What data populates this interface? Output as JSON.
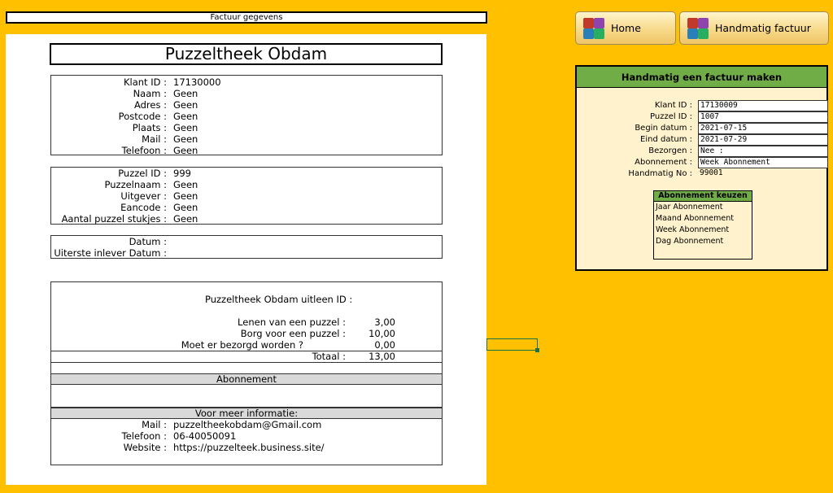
{
  "sheet": {
    "title_bar": "Factuur gegevens",
    "shop_name": "Puzzeltheek Obdam"
  },
  "customer": {
    "rows": [
      {
        "label": "Klant ID :",
        "value": "17130000"
      },
      {
        "label": "Naam :",
        "value": "Geen"
      },
      {
        "label": "Adres :",
        "value": "Geen"
      },
      {
        "label": "Postcode :",
        "value": "Geen"
      },
      {
        "label": "Plaats :",
        "value": "Geen"
      },
      {
        "label": "Mail :",
        "value": "Geen"
      },
      {
        "label": "Telefoon :",
        "value": "Geen"
      }
    ]
  },
  "puzzle": {
    "rows": [
      {
        "label": "Puzzel ID :",
        "value": "999"
      },
      {
        "label": "Puzzelnaam :",
        "value": "Geen"
      },
      {
        "label": "Uitgever :",
        "value": "Geen"
      },
      {
        "label": "Eancode :",
        "value": "Geen"
      },
      {
        "label": "Aantal puzzel stukjes :",
        "value": "Geen"
      }
    ]
  },
  "dates": {
    "rows": [
      {
        "label": "Datum :",
        "value": ""
      },
      {
        "label": "Uiterste inlever Datum :",
        "value": ""
      }
    ]
  },
  "costs": {
    "loan_id_label": "Puzzeltheek Obdam uitleen ID :",
    "lines": [
      {
        "label": "Lenen van een puzzel :",
        "amount": "3,00"
      },
      {
        "label": "Borg voor een puzzel :",
        "amount": "10,00"
      },
      {
        "label": "Moet er bezorgd worden ?",
        "amount": "0,00"
      }
    ],
    "total_label": "Totaal :",
    "total_amount": "13,00",
    "subscription_header": "Abonnement",
    "info_header": "Voor meer informatie:",
    "info_rows": [
      {
        "label": "Mail :",
        "value": "puzzeltheekobdam@Gmail.com"
      },
      {
        "label": "Telefoon :",
        "value": "06-40050091"
      },
      {
        "label": "Website :",
        "value": "https://puzzelteek.business.site/"
      }
    ]
  },
  "buttons": {
    "home": "Home",
    "manual_invoice": "Handmatig factuur"
  },
  "panel": {
    "title": "Handmatig een factuur maken",
    "fields": [
      {
        "label": "Klant ID :",
        "value": "17130009"
      },
      {
        "label": "Puzzel ID :",
        "value": "1007"
      },
      {
        "label": "Begin datum :",
        "value": "2021-07-15"
      },
      {
        "label": "Eind datum :",
        "value": "2021-07-29"
      },
      {
        "label": "Bezorgen :",
        "value": "Nee :"
      },
      {
        "label": "Abonnement :",
        "value": "Week Abonnement"
      }
    ],
    "manual_no_label": "Handmatig No :",
    "manual_no_value": "99001",
    "list_title": "Abonnement keuzen",
    "list_items": [
      "Jaar Abonnement",
      "Maand Abonnement",
      "Week Abonnement",
      "Dag Abonnement"
    ]
  },
  "colors": {
    "background": "#ffc000",
    "panel_fill": "#fff2cc",
    "panel_header": "#70ad47",
    "section_header": "#d9d9d9"
  },
  "icons": {
    "buttons": "puzzle-pieces-icon"
  }
}
